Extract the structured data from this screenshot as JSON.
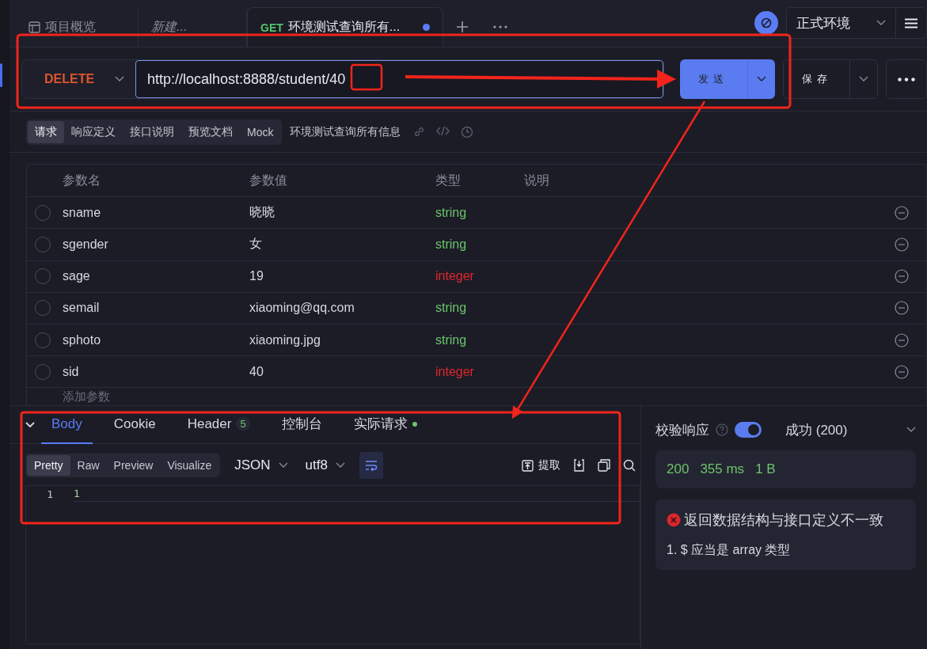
{
  "tabs": [
    {
      "kind": "overview",
      "label": "项目概览",
      "selected": false
    },
    {
      "kind": "draft",
      "label": "新建...",
      "selected": false
    },
    {
      "kind": "request",
      "method": "GET",
      "label": "环境测试查询所有...",
      "selected": true,
      "unsaved": true
    }
  ],
  "environment": {
    "label": "正式环境"
  },
  "request": {
    "method": "DELETE",
    "url": "http://localhost:8888/student/40",
    "send": "发送",
    "save": "保存"
  },
  "sub_tabs": [
    {
      "label": "请求",
      "selected": true
    },
    {
      "label": "响应定义",
      "selected": false
    },
    {
      "label": "接口说明",
      "selected": false
    },
    {
      "label": "预览文档",
      "selected": false
    },
    {
      "label": "Mock",
      "selected": false
    }
  ],
  "api_name": "环境测试查询所有信息",
  "params": {
    "columns": [
      "参数名",
      "参数值",
      "类型",
      "说明"
    ],
    "rows": [
      {
        "name": "sname",
        "value": "晓晓",
        "type": "string",
        "color": "#6cc46c",
        "checked": false
      },
      {
        "name": "sgender",
        "value": "女",
        "type": "string",
        "color": "#6cc46c",
        "checked": false
      },
      {
        "name": "sage",
        "value": "19",
        "type": "integer",
        "color": "#e0262c",
        "checked": false
      },
      {
        "name": "semail",
        "value": "xiaoming@qq.com",
        "type": "string",
        "color": "#6cc46c",
        "checked": false
      },
      {
        "name": "sphoto",
        "value": "xiaoming.jpg",
        "type": "string",
        "color": "#6cc46c",
        "checked": false
      },
      {
        "name": "sid",
        "value": "40",
        "type": "integer",
        "color": "#e0262c",
        "checked": false
      }
    ],
    "add_label": "添加参数"
  },
  "response": {
    "tabs": [
      {
        "label": "Body",
        "selected": true
      },
      {
        "label": "Cookie",
        "selected": false
      },
      {
        "label": "Header",
        "badge": "5",
        "selected": false
      },
      {
        "label": "控制台",
        "selected": false
      },
      {
        "label": "实际请求",
        "dot": true,
        "selected": false
      }
    ],
    "view_modes": [
      {
        "label": "Pretty",
        "selected": true
      },
      {
        "label": "Raw",
        "selected": false
      },
      {
        "label": "Preview",
        "selected": false
      },
      {
        "label": "Visualize",
        "selected": false
      }
    ],
    "format": "JSON",
    "encoding": "utf8",
    "wrap": true,
    "extract": "提取",
    "lines": [
      {
        "number": "1",
        "text": "1"
      }
    ]
  },
  "validation": {
    "label": "校验响应",
    "enabled": true,
    "result": "成功 (200)",
    "status": "200",
    "time": "355 ms",
    "size": "1 B",
    "error": "返回数据结构与接口定义不一致",
    "details": [
      "1. $ 应当是 array 类型"
    ]
  }
}
